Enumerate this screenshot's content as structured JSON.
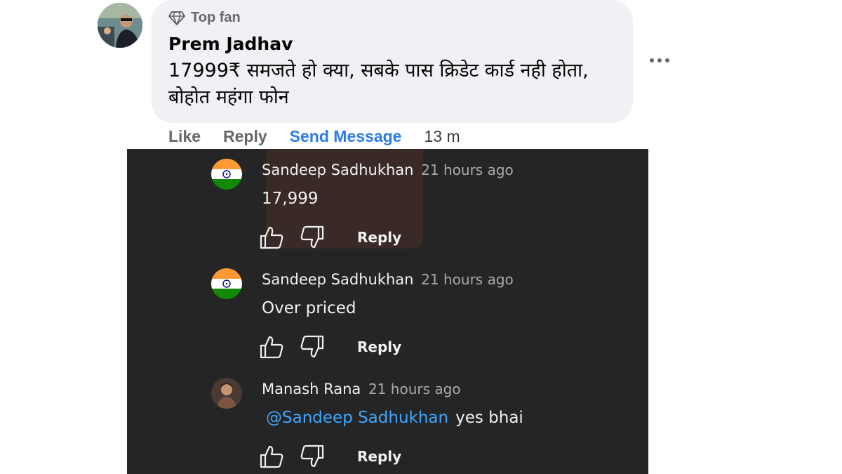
{
  "fb_comment": {
    "badge": "Top fan",
    "author": "Prem Jadhav",
    "text": "17999₹ समजते हो क्या, सबके पास क्रिडेट कार्ड नही होता, बोहोत महंगा फोन",
    "actions": {
      "like": "Like",
      "reply": "Reply",
      "send_message": "Send Message",
      "time": "13 m"
    },
    "icons": {
      "badge": "diamond-icon",
      "more": "more-options-icon"
    },
    "colors": {
      "bubble": "#eff1f4",
      "send_message": "#2d7be8"
    }
  },
  "yt_comments": [
    {
      "author": "Sandeep Sadhukhan",
      "time": "21 hours ago",
      "mention": "",
      "text": "17,999",
      "reply_label": "Reply",
      "avatar": "india-flag-avatar"
    },
    {
      "author": "Sandeep Sadhukhan",
      "time": "21 hours ago",
      "mention": "",
      "text": "Over priced",
      "reply_label": "Reply",
      "avatar": "india-flag-avatar"
    },
    {
      "author": "Manash Rana",
      "time": "21 hours ago",
      "mention": "@Sandeep Sadhukhan",
      "text": "yes bhai",
      "reply_label": "Reply",
      "avatar": "user-photo-avatar"
    }
  ],
  "yt_theme": {
    "background": "#252525",
    "mention_color": "#3ea6ff"
  }
}
